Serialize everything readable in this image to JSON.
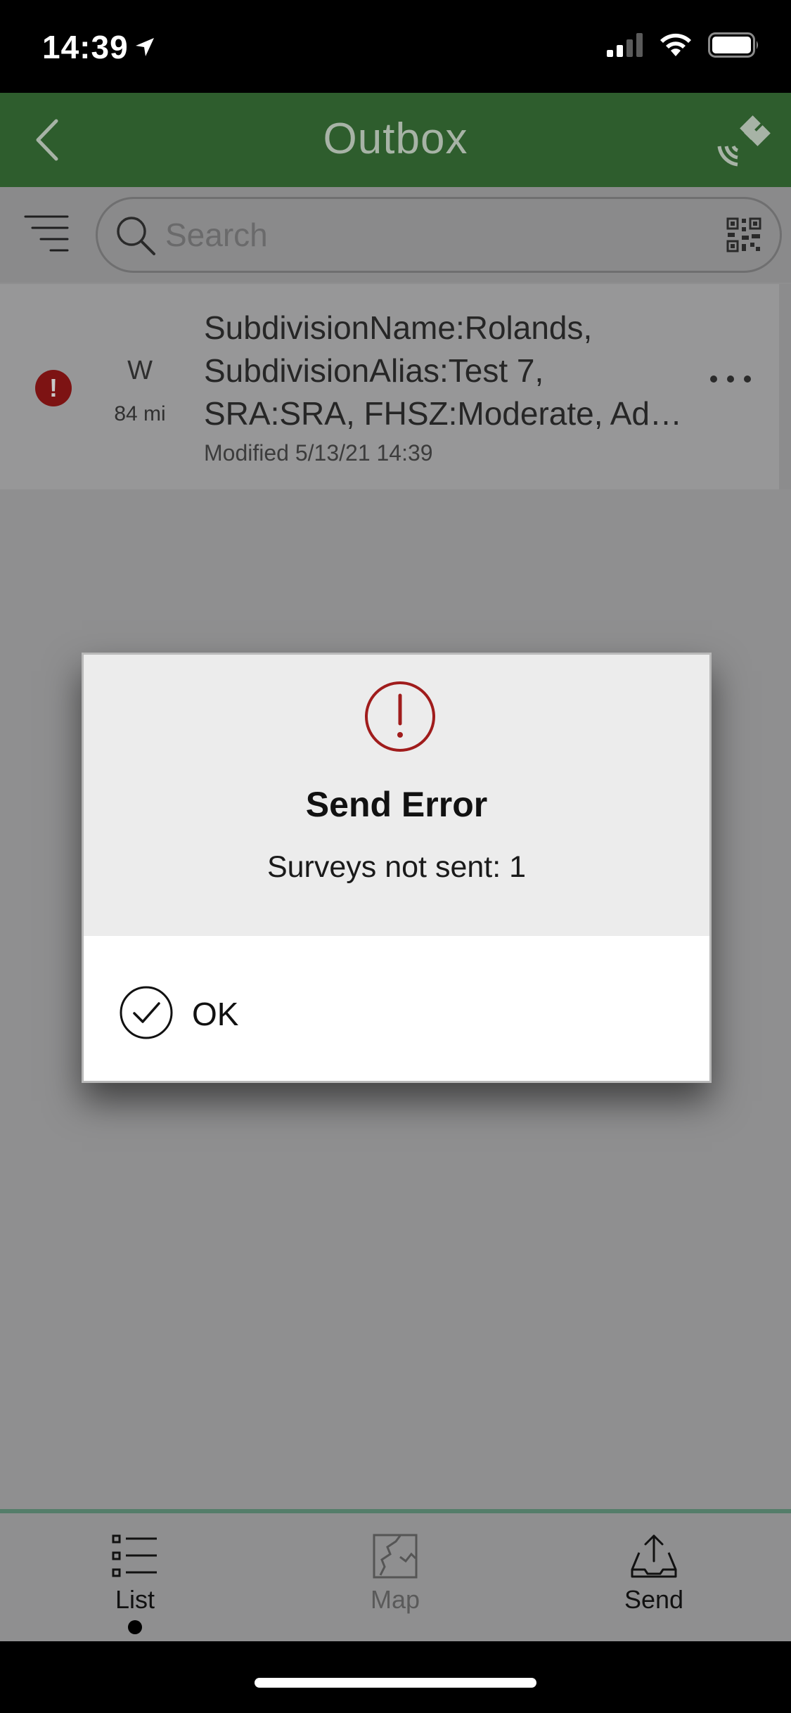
{
  "status_bar": {
    "time": "14:39"
  },
  "nav": {
    "title": "Outbox"
  },
  "search": {
    "placeholder": "Search"
  },
  "list": {
    "items": [
      {
        "direction": "W",
        "distance": "84 mi",
        "title_line1": "SubdivisionName:Rolands,",
        "title_line2": "SubdivisionAlias:Test 7,",
        "title_line3": "SRA:SRA, FHSZ:Moderate, Ad…",
        "modified": "Modified 5/13/21 14:39"
      }
    ]
  },
  "dialog": {
    "title": "Send Error",
    "message": "Surveys not sent: 1",
    "ok_label": "OK"
  },
  "tabs": [
    {
      "label": "List",
      "active": true
    },
    {
      "label": "Map",
      "active": false
    },
    {
      "label": "Send",
      "active": false
    }
  ],
  "colors": {
    "nav_green": "#2e5d2d",
    "error_red": "#a01c1c",
    "overlay_gray": "#8f8f90"
  }
}
